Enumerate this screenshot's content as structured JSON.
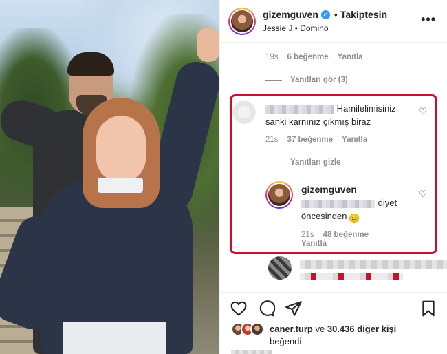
{
  "post": {
    "username": "gizemguven",
    "follow_separator": "•",
    "follow_label": "Takiptesin",
    "audio": "Jessie J • Domino",
    "more": "•••"
  },
  "thread_top": {
    "time": "19s",
    "likes": "6 beğenme",
    "reply": "Yanıtla",
    "view_replies": "Yanıtları gör (3)"
  },
  "highlighted_comment": {
    "text": "Hamilelimisiniz sanki karnınız çıkmış biraz",
    "time": "21s",
    "likes": "37 beğenme",
    "reply": "Yanıtla",
    "hide_replies": "Yanıtları gizle"
  },
  "owner_reply": {
    "username": "gizemguven",
    "text_part1": "diyet",
    "text_part2": "öncesinden",
    "emoji": "🤣",
    "time": "21s",
    "likes": "48 beğenme",
    "reply": "Yanıtla"
  },
  "likes": {
    "first_liker": "caner.turp",
    "connector": "ve",
    "others": "30.436 diğer kişi",
    "suffix": "beğendi"
  },
  "colors": {
    "highlight_border": "#c8102e",
    "verified": "#3897f0",
    "meta_text": "#8e8e8e"
  },
  "icons": [
    "heart-icon",
    "comment-icon",
    "share-icon",
    "save-icon",
    "verified-icon",
    "more-icon"
  ]
}
